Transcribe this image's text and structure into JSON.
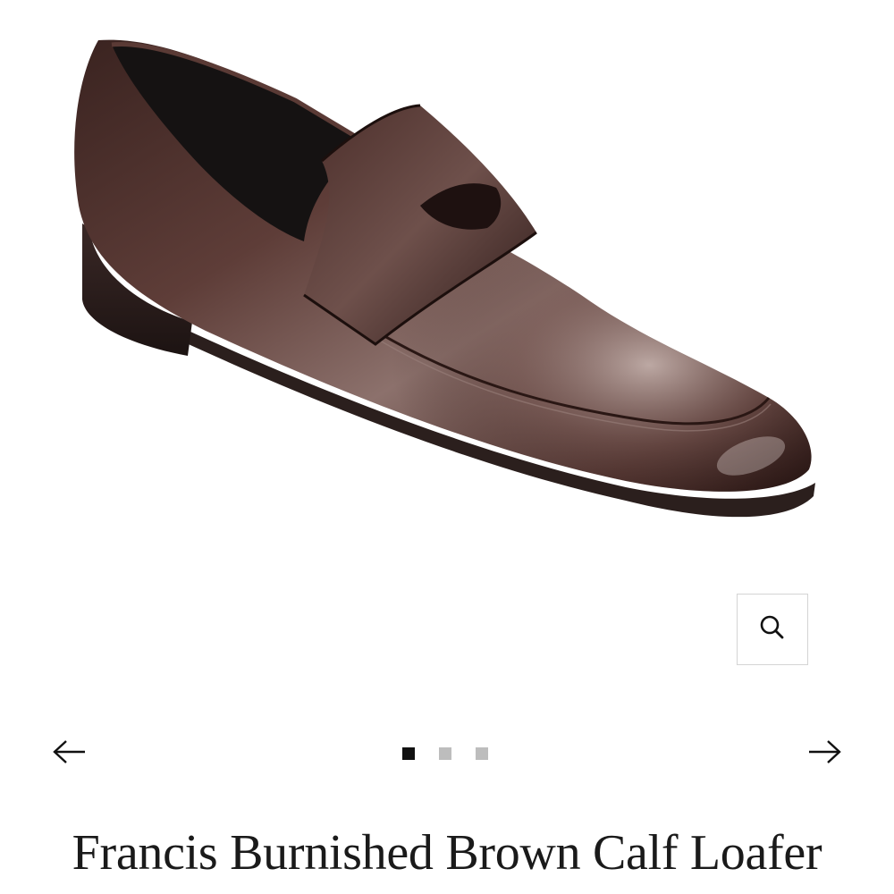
{
  "product": {
    "title": "Francis Burnished Brown Calf Loafer",
    "image": {
      "subject": "brown-calf-penny-loafer",
      "colors": {
        "leather_dark": "#2a1714",
        "leather_mid": "#5c3b36",
        "leather_highlight": "#b19a96",
        "lining": "#151212",
        "sole": "#2b1f1d"
      }
    }
  },
  "gallery": {
    "zoom_icon": "magnifier-icon",
    "prev_icon": "arrow-left-icon",
    "next_icon": "arrow-right-icon",
    "dots": [
      {
        "active": true
      },
      {
        "active": false
      },
      {
        "active": false
      }
    ]
  }
}
